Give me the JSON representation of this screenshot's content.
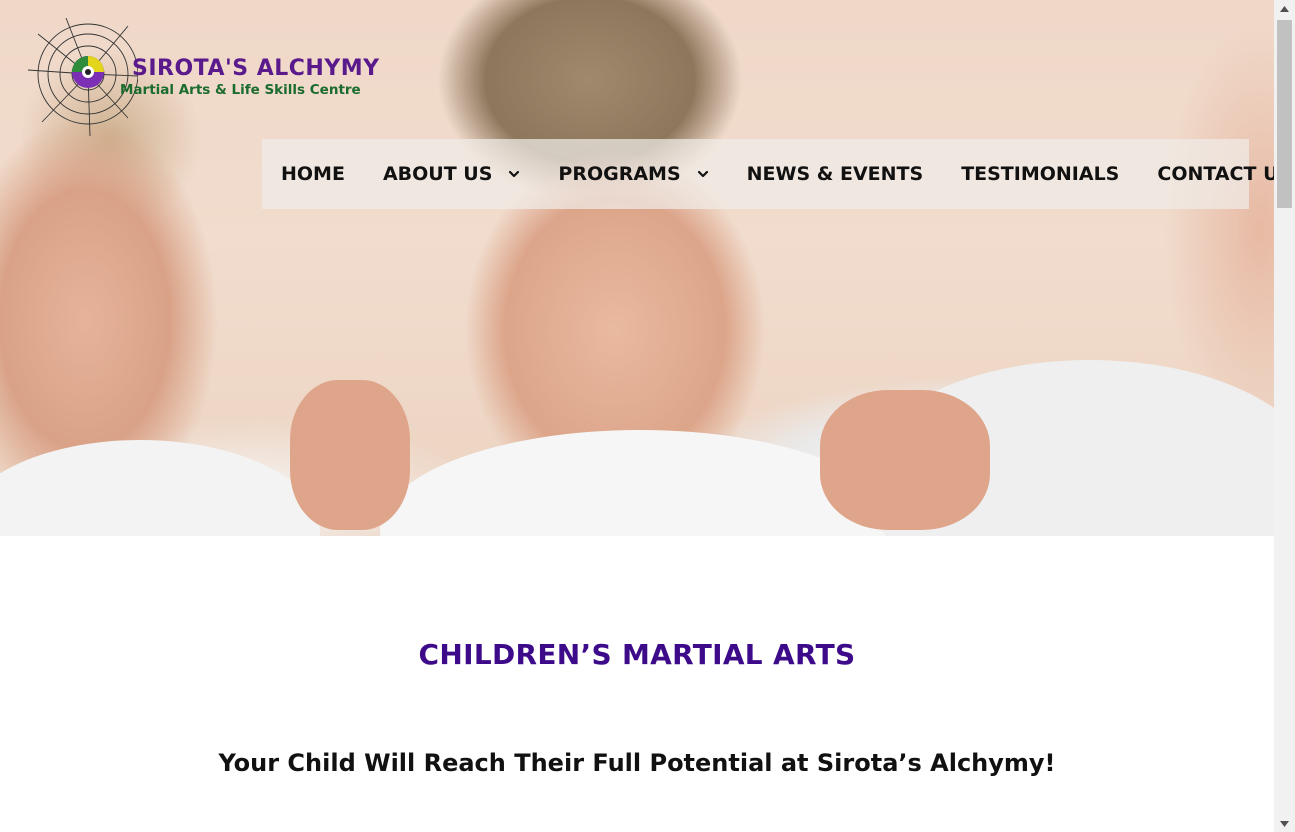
{
  "logo": {
    "title": "SIROTA'S ALCHYMY",
    "subtitle": "Martial Arts & Life Skills Centre"
  },
  "nav": {
    "items": [
      {
        "label": "HOME",
        "dropdown": false
      },
      {
        "label": "ABOUT US",
        "dropdown": true
      },
      {
        "label": "PROGRAMS",
        "dropdown": true
      },
      {
        "label": "NEWS & EVENTS",
        "dropdown": false
      },
      {
        "label": "TESTIMONIALS",
        "dropdown": false
      },
      {
        "label": "CONTACT US",
        "dropdown": false
      }
    ]
  },
  "content": {
    "heading": "CHILDREN’S MARTIAL ARTS",
    "subheading": "Your Child Will Reach Their Full Potential at Sirota’s Alchymy!"
  },
  "colors": {
    "heading": "#3d0b8a",
    "logo_title": "#5a1a8c",
    "logo_subtitle": "#1a6b2e",
    "nav_text": "#111111"
  },
  "icons": {
    "dropdown": "chevron-down-icon",
    "scroll_up": "arrow-up-icon",
    "scroll_down": "arrow-down-icon"
  }
}
